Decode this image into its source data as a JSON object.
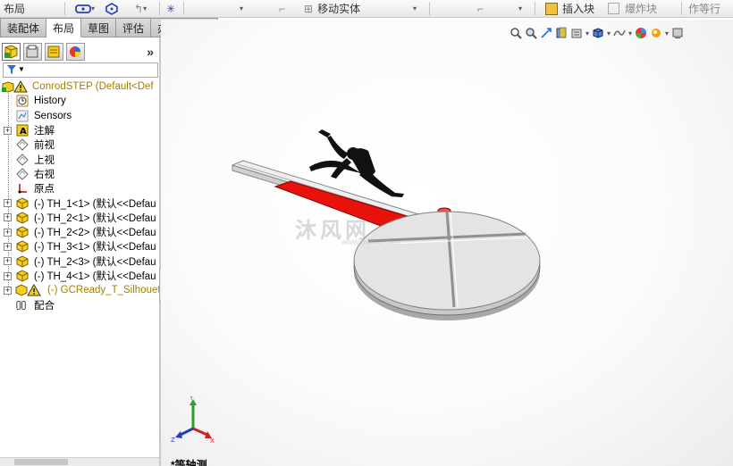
{
  "ribbon": {
    "left_label": "布局",
    "move_label": "移动实体",
    "insert_block_label": "插入块",
    "explode_block_label": "爆炸块",
    "right_label": "作等行"
  },
  "command_tabs": [
    "装配体",
    "布局",
    "草图",
    "评估",
    "办公室产品"
  ],
  "active_tab_index": 1,
  "panel": {
    "expand_glyph": "»",
    "tree": [
      {
        "label": "ConrodSTEP  (Default<Def",
        "icon": "assembly-warning",
        "expander": false,
        "color": "yellow"
      },
      {
        "label": "History",
        "icon": "history-icon",
        "expander": false
      },
      {
        "label": "Sensors",
        "icon": "sensors-icon",
        "expander": false
      },
      {
        "label": "注解",
        "icon": "annotation-icon",
        "expander": true
      },
      {
        "label": "前视",
        "icon": "plane-icon",
        "expander": false
      },
      {
        "label": "上视",
        "icon": "plane-icon",
        "expander": false
      },
      {
        "label": "右视",
        "icon": "plane-icon",
        "expander": false
      },
      {
        "label": "原点",
        "icon": "origin-icon",
        "expander": false
      },
      {
        "label": "(-) TH_1<1> (默认<<Defau",
        "icon": "part-icon",
        "expander": true
      },
      {
        "label": "(-) TH_2<1> (默认<<Defau",
        "icon": "part-icon",
        "expander": true
      },
      {
        "label": "(-) TH_2<2> (默认<<Defau",
        "icon": "part-icon",
        "expander": true
      },
      {
        "label": "(-) TH_3<1> (默认<<Defau",
        "icon": "part-icon",
        "expander": true
      },
      {
        "label": "(-) TH_2<3> (默认<<Defau",
        "icon": "part-icon",
        "expander": true
      },
      {
        "label": "(-) TH_4<1> (默认<<Defau",
        "icon": "part-icon",
        "expander": true
      },
      {
        "label": "(-) GCReady_T_Silhouett",
        "icon": "part-warning-icon",
        "expander": true,
        "color": "yellow"
      },
      {
        "label": "配合",
        "icon": "mates-icon",
        "expander": false
      }
    ]
  },
  "viewport": {
    "watermark_main": "沐风网",
    "watermark_sub": "www.mfcad.com",
    "view_label": "*等轴测",
    "triad": {
      "x": "X",
      "y": "Y",
      "z": "Z"
    }
  },
  "colors": {
    "arm_red": "#e8120c",
    "disk_face": "#e4e4e4",
    "disk_edge": "#c8c8c8",
    "tab_active": "#ffffff",
    "warning_yellow": "#a08000"
  }
}
